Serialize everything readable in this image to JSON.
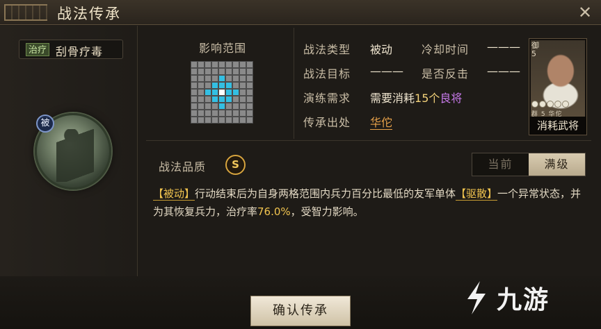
{
  "window": {
    "title": "战法传承",
    "close_icon": "close-icon"
  },
  "skill": {
    "tag": "治疗",
    "name": "刮骨疗毒",
    "passive_badge": "被"
  },
  "range": {
    "label": "影响范围"
  },
  "info": {
    "type_label": "战法类型",
    "type_value": "被动",
    "cooldown_label": "冷却时间",
    "cooldown_value": "———",
    "target_label": "战法目标",
    "target_value": "———",
    "counter_label": "是否反击",
    "counter_value": "———",
    "require_label": "演练需求",
    "require_prefix": "需要消耗",
    "require_count": "15个",
    "require_item": "良将",
    "source_label": "传承出处",
    "source_value": "华佗"
  },
  "hero_card": {
    "cost": "御\n5",
    "faction": "群",
    "cost_num": "5",
    "name": "华佗",
    "stars": 5,
    "label": "消耗武将"
  },
  "quality": {
    "label": "战法品质",
    "grade": "S"
  },
  "level_toggle": {
    "current": "当前",
    "max": "满级",
    "selected": "满级"
  },
  "description": {
    "tag": "【被动】",
    "text1": "行动结束后为自身两格范围内兵力百分比最低的友军单体",
    "key1": "【驱散】",
    "text2": "一个异常状态，并为其恢复兵力，治疗率",
    "rate": "76.0%",
    "text3": "，受智力影响。"
  },
  "footer": {
    "confirm_label": "确认传承"
  },
  "watermark": {
    "text": "九游"
  },
  "colors": {
    "grid_area": "#33bfe3",
    "grid_self": "#ffffff",
    "quality_gold": "#d7a43e",
    "highlight_purple": "#c679e8",
    "source_orange": "#e8a24a"
  }
}
